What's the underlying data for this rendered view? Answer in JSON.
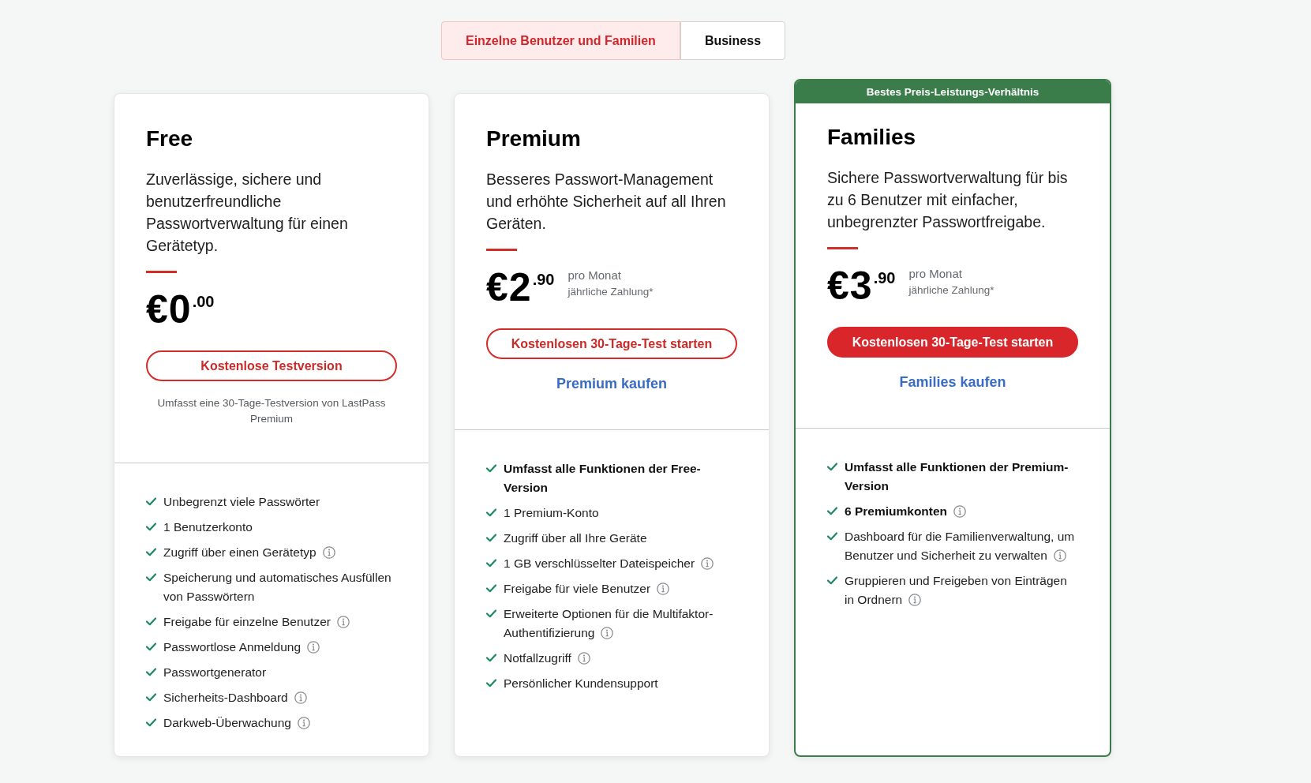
{
  "tabs": [
    {
      "label": "Einzelne Benutzer und Familien",
      "selected": true
    },
    {
      "label": "Business",
      "selected": false
    }
  ],
  "plans": [
    {
      "name": "Free",
      "featured": false,
      "description": "Zuverlässige, sichere und benutzerfreundliche Passwortverwaltung für einen Gerätetyp.",
      "price": {
        "amount": "€0",
        "cents": ".00"
      },
      "cta": {
        "label": "Kostenlose Testversion",
        "kind": "outline"
      },
      "note": "Umfasst eine 30-Tage-Testversion von LastPass Premium",
      "features": [
        {
          "text": "Unbegrenzt viele Passwörter",
          "bold": false,
          "info": false
        },
        {
          "text": "1 Benutzerkonto",
          "bold": false,
          "info": false
        },
        {
          "text": "Zugriff über einen Gerätetyp",
          "bold": false,
          "info": true
        },
        {
          "text": "Speicherung und automatisches Ausfüllen von Passwörtern",
          "bold": false,
          "info": false
        },
        {
          "text": "Freigabe für einzelne Benutzer",
          "bold": false,
          "info": true
        },
        {
          "text": "Passwortlose Anmeldung",
          "bold": false,
          "info": true
        },
        {
          "text": "Passwortgenerator",
          "bold": false,
          "info": false
        },
        {
          "text": "Sicherheits-Dashboard",
          "bold": false,
          "info": true
        },
        {
          "text": "Darkweb-Überwachung",
          "bold": false,
          "info": true
        }
      ]
    },
    {
      "name": "Premium",
      "featured": false,
      "description": "Besseres Passwort-Management und erhöhte Sicherheit auf all Ihren Geräten.",
      "price": {
        "amount": "€2",
        "cents": ".90",
        "period": "pro Monat",
        "billing": "jährliche Zahlung*"
      },
      "cta": {
        "label": "Kostenlosen 30-Tage-Test starten",
        "kind": "outline"
      },
      "buy_link": "Premium kaufen",
      "features": [
        {
          "text": "Umfasst alle Funktionen der Free-Version",
          "bold": true,
          "info": false
        },
        {
          "text": "1 Premium-Konto",
          "bold": false,
          "info": false
        },
        {
          "text": "Zugriff über all Ihre Geräte",
          "bold": false,
          "info": false
        },
        {
          "text": "1 GB verschlüsselter Dateispeicher",
          "bold": false,
          "info": true
        },
        {
          "text": "Freigabe für viele Benutzer",
          "bold": false,
          "info": true
        },
        {
          "text": "Erweiterte Optionen für die Multifaktor-Authentifizierung",
          "bold": false,
          "info": true
        },
        {
          "text": "Notfallzugriff",
          "bold": false,
          "info": true
        },
        {
          "text": "Persönlicher Kundensupport",
          "bold": false,
          "info": false
        }
      ]
    },
    {
      "name": "Families",
      "featured": true,
      "badge": "Bestes Preis-Leistungs-Verhältnis",
      "description": "Sichere Passwortverwaltung für bis zu 6 Benutzer mit einfacher, unbegrenzter Passwortfreigabe.",
      "price": {
        "amount": "€3",
        "cents": ".90",
        "period": "pro Monat",
        "billing": "jährliche Zahlung*"
      },
      "cta": {
        "label": "Kostenlosen 30-Tage-Test starten",
        "kind": "filled"
      },
      "buy_link": "Families kaufen",
      "features": [
        {
          "text": "Umfasst alle Funktionen der Premium-Version",
          "bold": true,
          "info": false
        },
        {
          "text": "6 Premiumkonten",
          "bold": true,
          "info": true
        },
        {
          "text": "Dashboard für die Familienverwaltung, um Benutzer und Sicherheit zu verwalten",
          "bold": false,
          "info": true
        },
        {
          "text": "Gruppieren und Freigeben von Einträgen in Ordnern",
          "bold": false,
          "info": true
        }
      ]
    }
  ]
}
